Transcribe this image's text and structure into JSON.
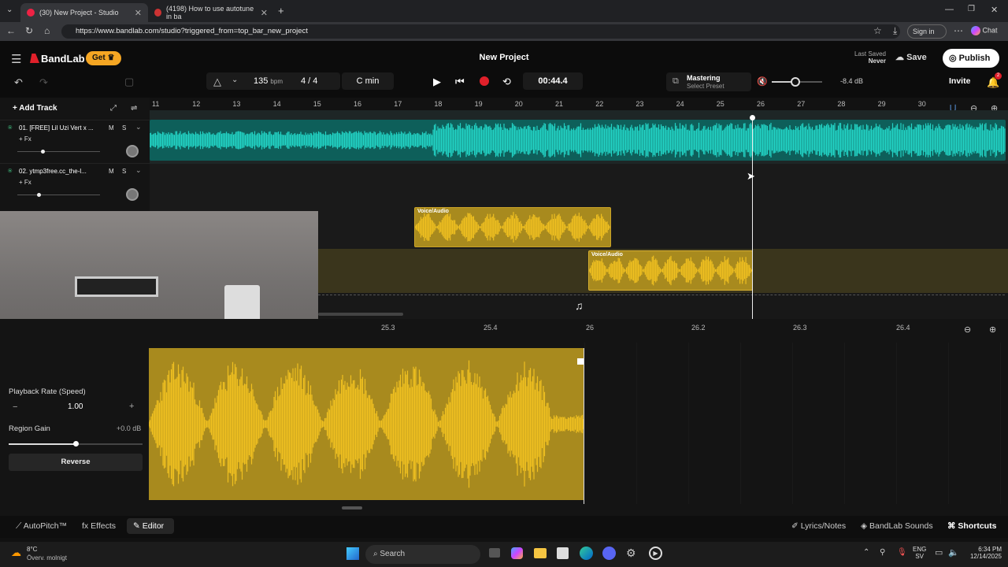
{
  "browser": {
    "tabs": [
      {
        "label": "(30) New Project - Studio",
        "active": true
      },
      {
        "label": "(4198) How to use autotune in ba",
        "active": false
      }
    ],
    "url": "https://www.bandlab.com/studio?triggered_from=top_bar_new_project",
    "signin_label": "Sign in",
    "chat_label": "Chat"
  },
  "app": {
    "logo": "BandLab",
    "get_label": "Get",
    "project_title": "New Project",
    "last_saved_label": "Last Saved",
    "last_saved_value": "Never",
    "save_label": "Save",
    "publish_label": "Publish",
    "invite_label": "Invite",
    "notification_count": "2",
    "bpm_value": "135",
    "bpm_unit": "bpm",
    "time_signature": "4 / 4",
    "key": "C min",
    "time": "00:44.4",
    "mastering_label": "Mastering",
    "mastering_sub": "Select Preset",
    "volume_db": "-8.4 dB",
    "add_track_label": "Add Track"
  },
  "ruler": {
    "labels": [
      "11",
      "12",
      "13",
      "14",
      "15",
      "16",
      "17",
      "18",
      "19",
      "20",
      "21",
      "22",
      "23",
      "24",
      "25",
      "26",
      "27",
      "28",
      "29",
      "30"
    ]
  },
  "tracks": [
    {
      "name": "01. [FREE] Lil Uzi Vert x ...",
      "fx": "+ Fx",
      "m": "M",
      "s": "S",
      "volume": 0.3
    },
    {
      "name": "02. ytmp3free.cc_the-l...",
      "fx": "+ Fx",
      "m": "M",
      "s": "S",
      "volume": 0.25
    }
  ],
  "regions": [
    {
      "label": "Voice/Audio"
    },
    {
      "label": "Voice/Audio"
    }
  ],
  "editor": {
    "ruler_labels": [
      "25.3",
      "25.4",
      "26",
      "26.2",
      "26.3",
      "26.4"
    ],
    "playback_rate_label": "Playback Rate (Speed)",
    "playback_rate_value": "1.00",
    "region_gain_label": "Region Gain",
    "region_gain_value": "+0.0 dB",
    "region_gain_level": 0.5,
    "reverse_label": "Reverse",
    "minus": "−",
    "plus": "+"
  },
  "bottombar": {
    "autopitch_label": "AutoPitch™",
    "effects_label": "Effects",
    "editor_label": "Editor",
    "lyrics_label": "Lyrics/Notes",
    "sounds_label": "BandLab Sounds",
    "shortcuts_label": "Shortcuts"
  },
  "taskbar": {
    "weather_temp": "8°C",
    "weather_desc": "Överv. molnigt",
    "search_placeholder": "Search",
    "lang": "ENG",
    "lang_sub": "SV",
    "clock_time": "6:34 PM",
    "clock_date": "12/14/2025"
  },
  "colors": {
    "cyan_track": "#22d3c5",
    "gold_region": "#c9a227",
    "gold_bright": "#f0c020",
    "accent_orange": "#f5a623",
    "record_red": "#e0202a"
  }
}
